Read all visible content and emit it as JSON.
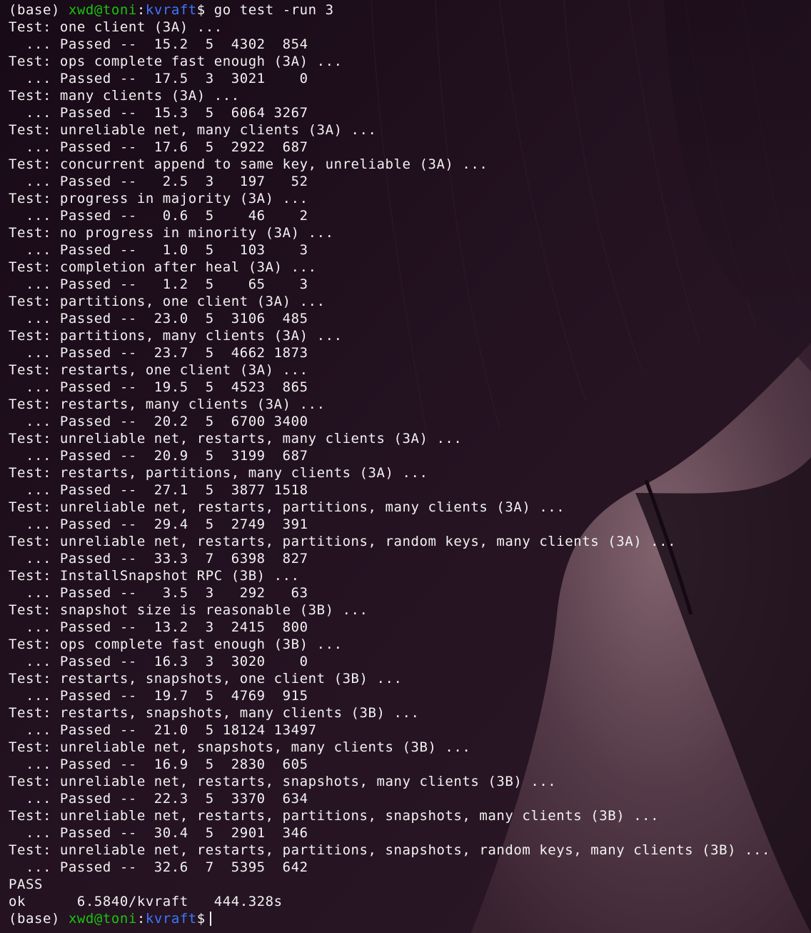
{
  "colors": {
    "background": "#1e0f1c",
    "text": "#f2f2f2",
    "prompt_user": "#16c60c",
    "prompt_dir": "#3b78ff"
  },
  "prompt_start": {
    "env": "(base)",
    "user_host": "xwd@toni",
    "separator": ":",
    "dir": "kvraft",
    "symbol": "$",
    "command": "go test -run 3"
  },
  "output": [
    "Test: one client (3A) ...",
    "  ... Passed --  15.2  5  4302  854",
    "Test: ops complete fast enough (3A) ...",
    "  ... Passed --  17.5  3  3021    0",
    "Test: many clients (3A) ...",
    "  ... Passed --  15.3  5  6064 3267",
    "Test: unreliable net, many clients (3A) ...",
    "  ... Passed --  17.6  5  2922  687",
    "Test: concurrent append to same key, unreliable (3A) ...",
    "  ... Passed --   2.5  3   197   52",
    "Test: progress in majority (3A) ...",
    "  ... Passed --   0.6  5    46    2",
    "Test: no progress in minority (3A) ...",
    "  ... Passed --   1.0  5   103    3",
    "Test: completion after heal (3A) ...",
    "  ... Passed --   1.2  5    65    3",
    "Test: partitions, one client (3A) ...",
    "  ... Passed --  23.0  5  3106  485",
    "Test: partitions, many clients (3A) ...",
    "  ... Passed --  23.7  5  4662 1873",
    "Test: restarts, one client (3A) ...",
    "  ... Passed --  19.5  5  4523  865",
    "Test: restarts, many clients (3A) ...",
    "  ... Passed --  20.2  5  6700 3400",
    "Test: unreliable net, restarts, many clients (3A) ...",
    "  ... Passed --  20.9  5  3199  687",
    "Test: restarts, partitions, many clients (3A) ...",
    "  ... Passed --  27.1  5  3877 1518",
    "Test: unreliable net, restarts, partitions, many clients (3A) ...",
    "  ... Passed --  29.4  5  2749  391",
    "Test: unreliable net, restarts, partitions, random keys, many clients (3A) ...",
    "  ... Passed --  33.3  7  6398  827",
    "Test: InstallSnapshot RPC (3B) ...",
    "  ... Passed --   3.5  3   292   63",
    "Test: snapshot size is reasonable (3B) ...",
    "  ... Passed --  13.2  3  2415  800",
    "Test: ops complete fast enough (3B) ...",
    "  ... Passed --  16.3  3  3020    0",
    "Test: restarts, snapshots, one client (3B) ...",
    "  ... Passed --  19.7  5  4769  915",
    "Test: restarts, snapshots, many clients (3B) ...",
    "  ... Passed --  21.0  5 18124 13497",
    "Test: unreliable net, snapshots, many clients (3B) ...",
    "  ... Passed --  16.9  5  2830  605",
    "Test: unreliable net, restarts, snapshots, many clients (3B) ...",
    "  ... Passed --  22.3  5  3370  634",
    "Test: unreliable net, restarts, partitions, snapshots, many clients (3B) ...",
    "  ... Passed --  30.4  5  2901  346",
    "Test: unreliable net, restarts, partitions, snapshots, random keys, many clients (3B) ...",
    "  ... Passed --  32.6  7  5395  642",
    "PASS",
    "ok      6.5840/kvraft   444.328s"
  ],
  "prompt_end": {
    "env": "(base)",
    "user_host": "xwd@toni",
    "separator": ":",
    "dir": "kvraft",
    "symbol": "$"
  },
  "background_image": "dark-photo-silhouette"
}
